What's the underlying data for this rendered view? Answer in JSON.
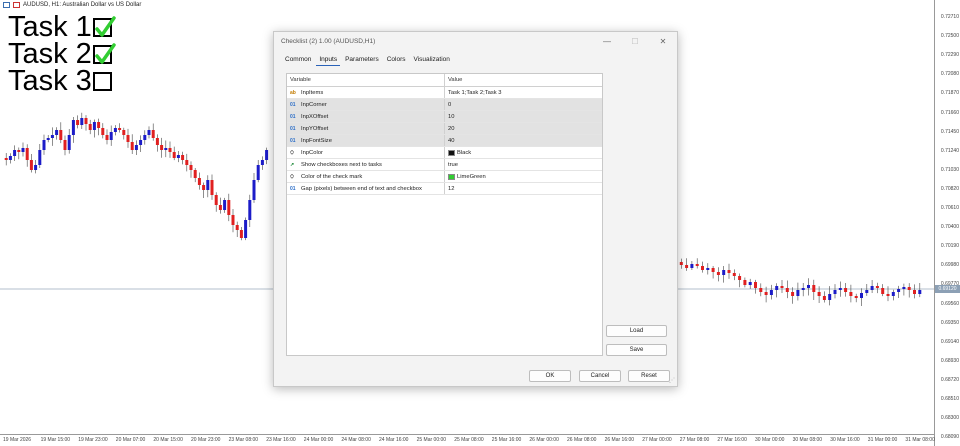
{
  "chart": {
    "title": "AUDUSD, H1: Australian Dollar vs US Dollar",
    "price_labels": [
      "0.72710",
      "0.72500",
      "0.72290",
      "0.72080",
      "0.71870",
      "0.71660",
      "0.71450",
      "0.71240",
      "0.71030",
      "0.70820",
      "0.70610",
      "0.70400",
      "0.70190",
      "0.69980",
      "0.69770",
      "0.69560",
      "0.69350",
      "0.69140",
      "0.68930",
      "0.68720",
      "0.68510",
      "0.68300",
      "0.68090"
    ],
    "current_price": "0.69120",
    "time_labels": [
      "19 Mar 2026",
      "19 Mar 15:00",
      "19 Mar 23:00",
      "20 Mar 07:00",
      "20 Mar 15:00",
      "20 Mar 23:00",
      "23 Mar 08:00",
      "23 Mar 16:00",
      "24 Mar 00:00",
      "24 Mar 08:00",
      "24 Mar 16:00",
      "25 Mar 00:00",
      "25 Mar 08:00",
      "25 Mar 16:00",
      "26 Mar 00:00",
      "26 Mar 08:00",
      "26 Mar 16:00",
      "27 Mar 00:00",
      "27 Mar 08:00",
      "27 Mar 16:00",
      "30 Mar 00:00",
      "30 Mar 08:00",
      "30 Mar 16:00",
      "31 Mar 00:00",
      "31 Mar 08:00"
    ],
    "colors": {
      "bull": "#1c1cc8",
      "bear": "#e02020",
      "grid_line": "#9aaabb"
    }
  },
  "tasks": [
    {
      "label": "Task 1",
      "checked": true
    },
    {
      "label": "Task 2",
      "checked": true
    },
    {
      "label": "Task 3",
      "checked": false
    }
  ],
  "check_color": "#32cd32",
  "dialog": {
    "title": "Checklist (2) 1.00 (AUDUSD,H1)",
    "minimize_glyph": "—",
    "maximize_glyph": "☐",
    "close_glyph": "✕",
    "tabs": [
      "Common",
      "Inputs",
      "Parameters",
      "Colors",
      "Visualization"
    ],
    "active_tab": 1,
    "columns": {
      "variable": "Variable",
      "value": "Value"
    },
    "rows": [
      {
        "icon": "ab",
        "name": "InpItems",
        "value": "Task 1;Task 2;Task 3",
        "swatch": null
      },
      {
        "icon": "01",
        "name": "InpCorner",
        "value": "0",
        "swatch": null
      },
      {
        "icon": "01",
        "name": "InpXOffset",
        "value": "10",
        "swatch": null
      },
      {
        "icon": "01",
        "name": "InpYOffset",
        "value": "20",
        "swatch": null
      },
      {
        "icon": "01",
        "name": "InpFontSize",
        "value": "40",
        "swatch": null
      },
      {
        "icon": "color",
        "name": "InpColor",
        "value": "Black",
        "swatch": "#111111"
      },
      {
        "icon": "bool",
        "name": "Show checkboxes next to tasks",
        "value": "true",
        "swatch": null
      },
      {
        "icon": "color",
        "name": "Color of the check mark",
        "value": "LimeGreen",
        "swatch": "#32cd32"
      },
      {
        "icon": "01",
        "name": "Gap (pixels) between end of text and checkbox",
        "value": "12",
        "swatch": null
      }
    ],
    "load_label": "Load",
    "save_label": "Save",
    "ok_label": "OK",
    "cancel_label": "Cancel",
    "reset_label": "Reset"
  }
}
